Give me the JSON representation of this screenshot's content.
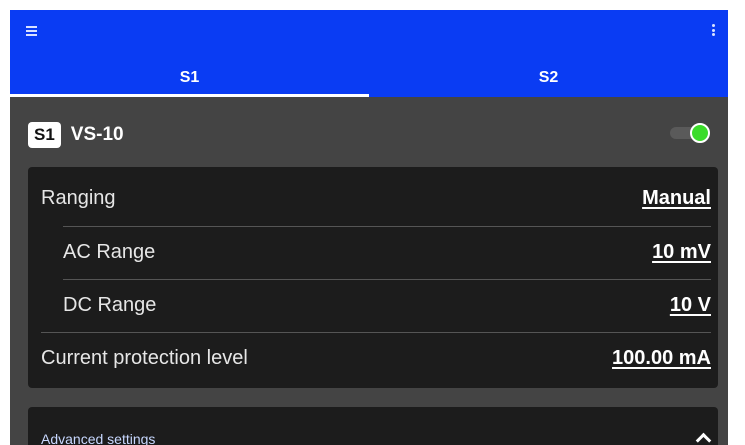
{
  "tabs": [
    {
      "label": "S1",
      "active": true
    },
    {
      "label": "S2",
      "active": false
    }
  ],
  "colors": {
    "appbar": "#0a3cf3",
    "background": "#444444",
    "card": "#1c1c1c",
    "toggle_on": "#3bdc2a"
  },
  "icons": {
    "menu": "hamburger-menu-icon",
    "more": "more-vertical-icon",
    "advanced_toggle": "chevron-up-icon"
  },
  "device": {
    "badge": "S1",
    "name": "VS-10",
    "enabled": true
  },
  "settings": {
    "ranging": {
      "label": "Ranging",
      "value": "Manual"
    },
    "ac_range": {
      "label": "AC Range",
      "value": "10 mV"
    },
    "dc_range": {
      "label": "DC Range",
      "value": "10 V"
    },
    "current_protection": {
      "label": "Current protection level",
      "value": "100.00 mA"
    }
  },
  "advanced": {
    "label": "Advanced settings"
  }
}
